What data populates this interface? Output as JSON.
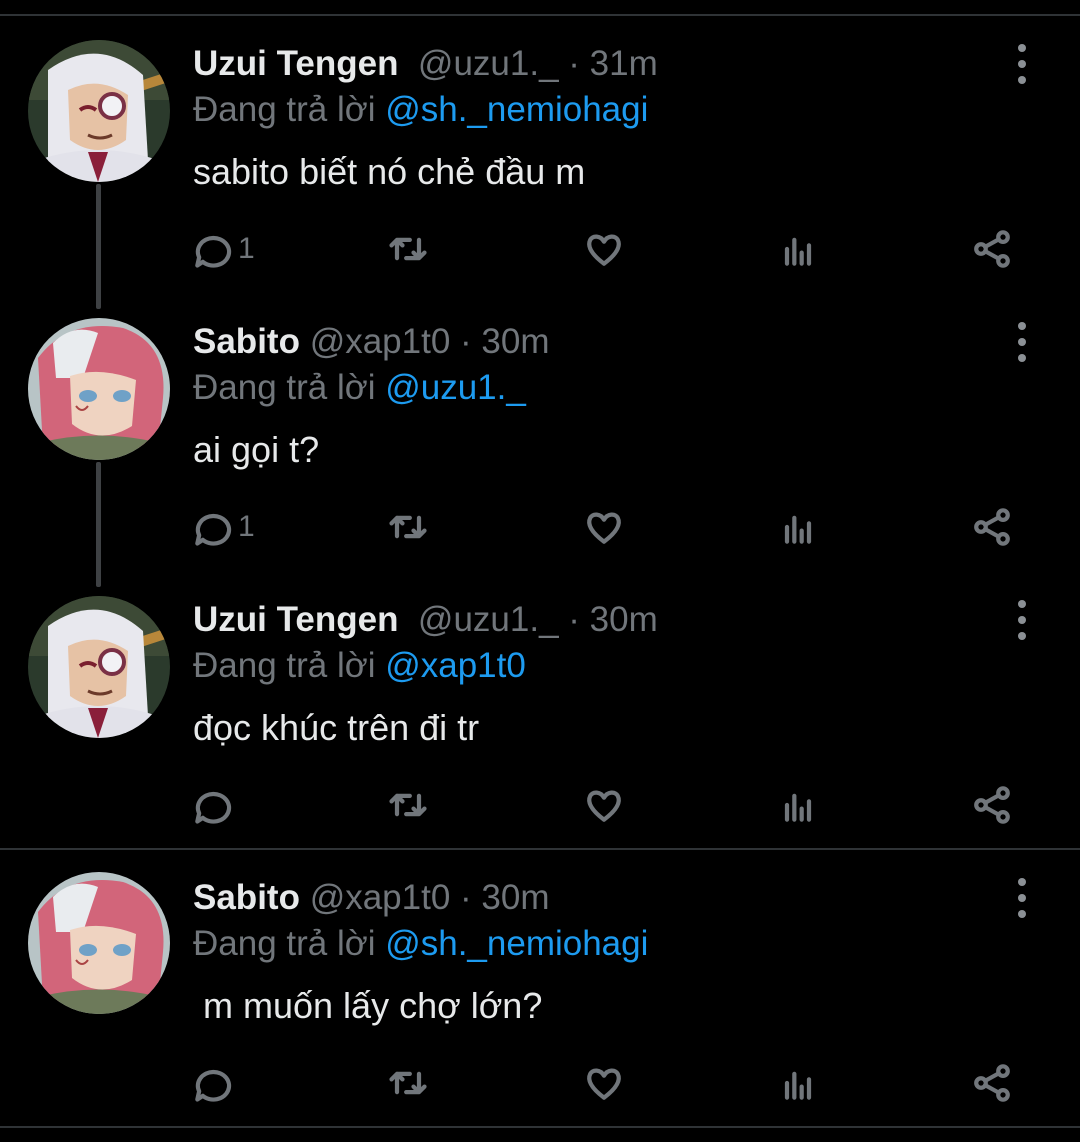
{
  "tweets": [
    {
      "name": "Uzui Tengen",
      "handle": "@uzu1._",
      "time": "· 31m",
      "reply_prefix": "Đang trả lời ",
      "reply_to": "@sh._nemiohagi",
      "text": "sabito biết nó chẻ đầu m",
      "reply_count": "1",
      "avatar": "uzui-avatar"
    },
    {
      "name": "Sabito",
      "handle": "@xap1t0",
      "time": "· 30m",
      "reply_prefix": "Đang trả lời ",
      "reply_to": "@uzu1._",
      "text": "ai gọi t?",
      "reply_count": "1",
      "avatar": "sabito-avatar"
    },
    {
      "name": "Uzui Tengen",
      "handle": "@uzu1._",
      "time": "· 30m",
      "reply_prefix": "Đang trả lời ",
      "reply_to": "@xap1t0",
      "text": "đọc khúc trên đi tr",
      "reply_count": "",
      "avatar": "uzui-avatar"
    },
    {
      "name": "Sabito",
      "handle": "@xap1t0",
      "time": "· 30m",
      "reply_prefix": "Đang trả lời ",
      "reply_to": "@sh._nemiohagi",
      "text": " m muốn lấy chợ lớn?",
      "reply_count": "",
      "avatar": "sabito-avatar"
    }
  ],
  "icons": {
    "reply": "reply-icon",
    "retweet": "retweet-icon",
    "like": "heart-icon",
    "analytics": "analytics-icon",
    "share": "share-icon",
    "more": "more-options-icon"
  },
  "colors": {
    "background": "#000000",
    "text": "#e7e9ea",
    "secondary": "#71767b",
    "link": "#1d9bf0",
    "divider": "#2f3336"
  }
}
